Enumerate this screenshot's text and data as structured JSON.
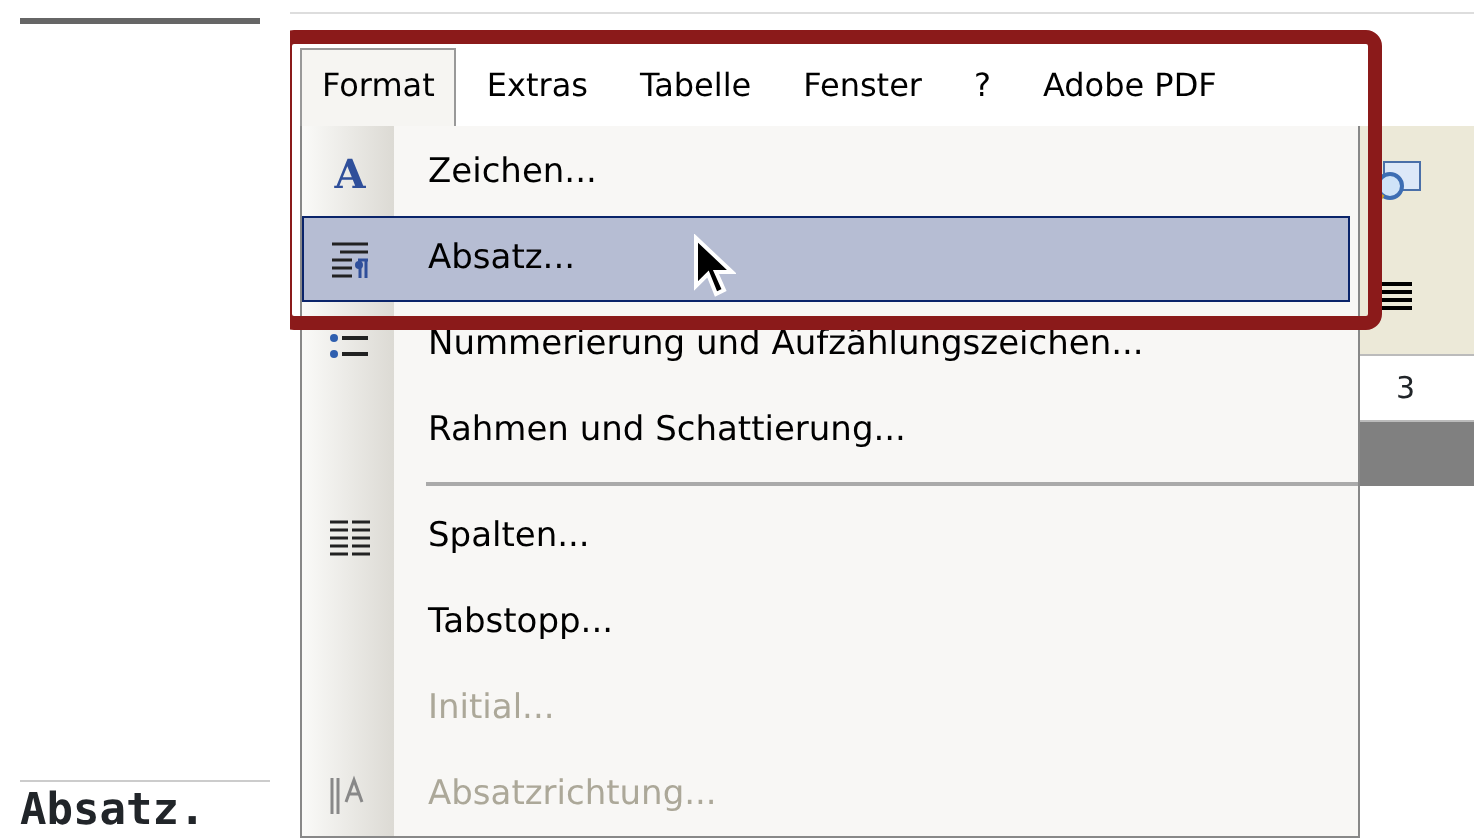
{
  "menubar": [
    {
      "label": "Format",
      "selected": true
    },
    {
      "label": "Extras",
      "selected": false
    },
    {
      "label": "Tabelle",
      "selected": false
    },
    {
      "label": "Fenster",
      "selected": false
    },
    {
      "label": "?",
      "selected": false
    },
    {
      "label": "Adobe PDF",
      "selected": false
    }
  ],
  "menu_items": [
    {
      "kind": "item",
      "label": "Zeichen...",
      "glyph": "A",
      "selected": false,
      "disabled": false
    },
    {
      "kind": "item",
      "label": "Absatz...",
      "selected": true,
      "disabled": false
    },
    {
      "kind": "item",
      "label": "Nummerierung und Aufzählungszeichen...",
      "selected": false,
      "disabled": false
    },
    {
      "kind": "item",
      "label": "Rahmen und Schattierung...",
      "selected": false,
      "disabled": false
    },
    {
      "kind": "separator"
    },
    {
      "kind": "item",
      "label": "Spalten...",
      "selected": false,
      "disabled": false
    },
    {
      "kind": "item",
      "label": "Tabstopp...",
      "selected": false,
      "disabled": false
    },
    {
      "kind": "item",
      "label": "Initial...",
      "selected": false,
      "disabled": true
    },
    {
      "kind": "item",
      "label": "Absatzrichtung...",
      "selected": false,
      "disabled": true
    }
  ],
  "ruler_mark": "3",
  "caption": "Absatz."
}
